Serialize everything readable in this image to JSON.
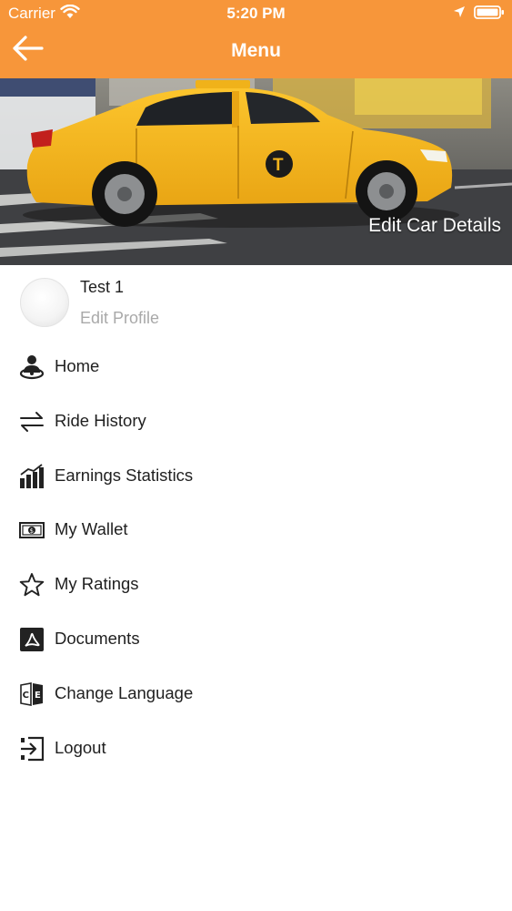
{
  "status_bar": {
    "carrier": "Carrier",
    "time": "5:20 PM"
  },
  "header": {
    "title": "Menu",
    "background_color": "#f7963a"
  },
  "hero": {
    "edit_car_label": "Edit Car Details",
    "taxi_color": "#f3b41c"
  },
  "profile": {
    "name": "Test 1",
    "edit_label": "Edit Profile"
  },
  "menu": {
    "items": [
      {
        "label": "Home",
        "icon": "driver-icon"
      },
      {
        "label": "Ride History",
        "icon": "swap-arrows-icon"
      },
      {
        "label": "Earnings Statistics",
        "icon": "bar-chart-icon"
      },
      {
        "label": "My Wallet",
        "icon": "banknote-icon"
      },
      {
        "label": "My Ratings",
        "icon": "star-outline-icon"
      },
      {
        "label": "Documents",
        "icon": "pdf-document-icon"
      },
      {
        "label": "Change Language",
        "icon": "translate-icon"
      },
      {
        "label": "Logout",
        "icon": "logout-icon"
      }
    ]
  }
}
